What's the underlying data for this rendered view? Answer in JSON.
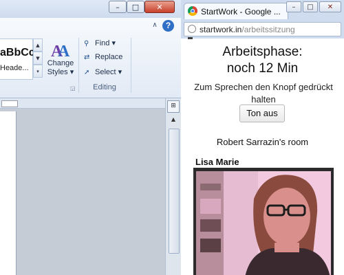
{
  "word": {
    "window_controls": {
      "minimize": "–",
      "maximize": "□",
      "close": "✕"
    },
    "ribbon": {
      "collapse_caret": "∧",
      "help": "?",
      "style_sample": "aBbCc",
      "style_name": "Heade...",
      "change_styles_line1": "Change",
      "change_styles_line2": "Styles ▾",
      "find": "Find ▾",
      "replace": "Replace",
      "select": "Select ▾",
      "editing_group_label": "Editing"
    }
  },
  "chrome": {
    "tab_title": "StartWork - Google ...",
    "window_controls": {
      "minimize": "–",
      "maximize": "□",
      "close": "✕"
    },
    "url_host": "startwork.in",
    "url_path": "/arbeitssitzung",
    "page": {
      "phase_line1": "Arbeitsphase:",
      "phase_line2": "noch 12 Min",
      "hint": "Zum Sprechen den Knopf gedrückt halten",
      "sound_button": "Ton aus",
      "room": "Robert Sarrazin's room",
      "participant": "Lisa Marie"
    }
  }
}
